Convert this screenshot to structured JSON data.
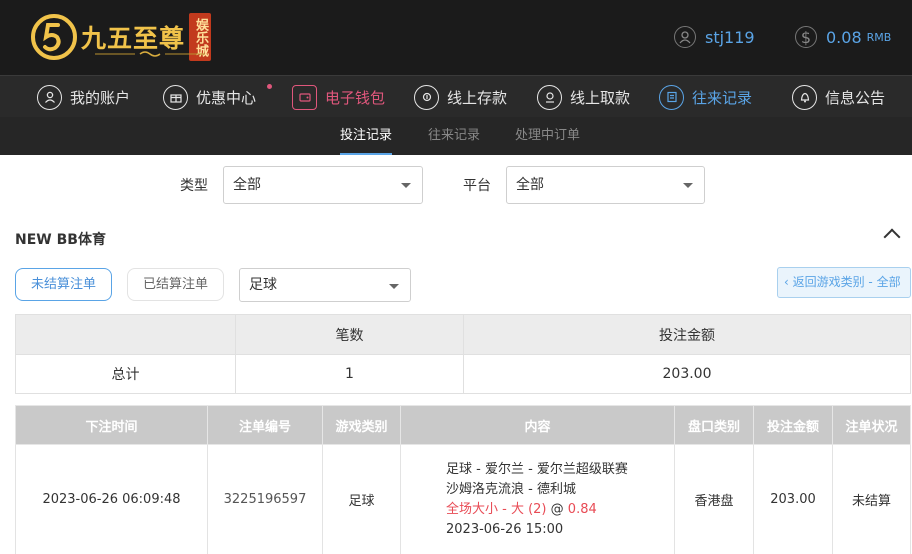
{
  "header": {
    "logo_text": "九五至尊",
    "logo_seal": "娱乐城",
    "username": "stj119",
    "balance": "0.08",
    "currency": "RMB"
  },
  "nav": [
    {
      "label": "我的账户",
      "icon": "user-icon"
    },
    {
      "label": "优惠中心",
      "icon": "gift-icon"
    },
    {
      "label": "电子钱包",
      "icon": "wallet-icon"
    },
    {
      "label": "线上存款",
      "icon": "deposit-icon"
    },
    {
      "label": "线上取款",
      "icon": "withdraw-icon"
    },
    {
      "label": "往来记录",
      "icon": "history-icon"
    },
    {
      "label": "信息公告",
      "icon": "bell-icon"
    }
  ],
  "subnav": [
    "投注记录",
    "往来记录",
    "处理中订单"
  ],
  "filters": {
    "type_label": "类型",
    "type_value": "全部",
    "platform_label": "平台",
    "platform_value": "全部"
  },
  "section": {
    "title": "NEW BB体育",
    "unsettled_label": "未结算注单",
    "settled_label": "已结算注单",
    "sport_value": "足球",
    "back_label": "‹ 返回游戏类别 - 全部"
  },
  "summary": {
    "headers": [
      "",
      "笔数",
      "投注金额"
    ],
    "row": [
      "总计",
      "1",
      "203.00"
    ]
  },
  "records": {
    "headers": [
      "下注时间",
      "注单编号",
      "游戏类别",
      "内容",
      "盘口类别",
      "投注金额",
      "注单状况"
    ],
    "rows": [
      {
        "time": "2023-06-26 06:09:48",
        "id": "3225196597",
        "category": "足球",
        "content_line1": "足球 - 爱尔兰 - 爱尔兰超级联赛",
        "content_line2": "沙姆洛克流浪 - 德利城",
        "bet_pick": "全场大小 - 大 (2)",
        "at": "@",
        "odds": "0.84",
        "match_time": "2023-06-26 15:00",
        "odds_type": "香港盘",
        "amount": "203.00",
        "status": "未结算"
      }
    ]
  },
  "colors": {
    "accent": "#5aa4e6",
    "wallet": "#e0577c",
    "gold": "#f1c34a",
    "highlight_red": "#e84b55"
  }
}
